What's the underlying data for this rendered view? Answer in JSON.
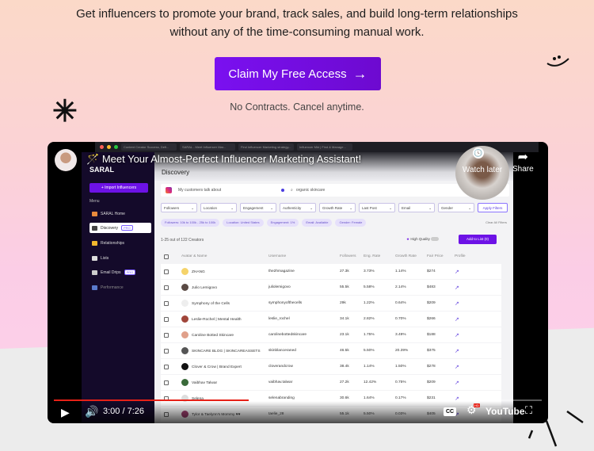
{
  "hero": {
    "line1": "Get influencers to promote your brand, track sales, and build long-term relationships",
    "line2": "without any of the time-consuming manual work.",
    "cta_label": "Claim My Free Access",
    "cta_arrow": "→",
    "subtext": "No Contracts. Cancel anytime."
  },
  "colors": {
    "accent": "#7a10f0",
    "youtube_red": "#e62117"
  },
  "video": {
    "title": "Meet Your Almost-Perfect Influencer Marketing Assistant!",
    "watch_later": "Watch later",
    "share": "Share",
    "time_current": "3:00",
    "time_total": "7:26",
    "time_display": "3:00 / 7:26",
    "progress_percent": 40,
    "cc_label": "CC",
    "hd_label": "HD",
    "youtube_label": "YouTube",
    "browser_tabs": [
      "Content Creator Success, Defi...",
      "SARAL - Meet Influencer Mar...",
      "Find Influencer Marketing strategy...",
      "Influencer Mkt | Find & Manage..."
    ]
  },
  "app": {
    "logo": "SARAL",
    "import_button": "+ Import Influencers",
    "menu_label": "Menu",
    "nav": [
      {
        "label": "SARAL Home",
        "badge": ""
      },
      {
        "label": "Discovery",
        "badge": "PRO"
      },
      {
        "label": "Relationships",
        "badge": ""
      },
      {
        "label": "Lists",
        "badge": ""
      },
      {
        "label": "Email Drips",
        "badge": "PRO"
      },
      {
        "label": "Performance",
        "badge": ""
      }
    ],
    "page_title": "Discovery",
    "search_left": "My customers talk about",
    "search_right": "organic skincare",
    "filters": [
      "Followers",
      "Location",
      "Engagement",
      "Authenticity",
      "Growth Rate",
      "Last Post",
      "Email",
      "Gender"
    ],
    "apply_filters": "Apply Filters",
    "chips": [
      "Followers: 10k to 100k - 25k to 100k",
      "Location: United States",
      "Engagement: 1%",
      "Email: Available",
      "Gender: Female"
    ],
    "clear_filters": "Clear All Filters",
    "result_count": "1-25 out of 122 Creators",
    "high_quality": "High Quality",
    "add_list": "Add to List (0)",
    "columns": [
      "Avatar & Name",
      "Username",
      "Followers",
      "Eng. Rate",
      "Growth Rate",
      "Fair Price",
      "Profile"
    ],
    "rows": [
      {
        "name": "ZHANG",
        "username": "the2hmagazine",
        "followers": "27.3k",
        "eng": "3.73%",
        "growth": "1.14%",
        "price": "$274"
      },
      {
        "name": "Julio Lemigovo",
        "username": "juliolemigovo",
        "followers": "55.5k",
        "eng": "5.58%",
        "growth": "2.14%",
        "price": "$483"
      },
      {
        "name": "Symphony of the Cells",
        "username": "symphonyofthecells",
        "followers": "29k",
        "eng": "1.22%",
        "growth": "0.64%",
        "price": "$209"
      },
      {
        "name": "Leslie-Rochel | Mental Health",
        "username": "leslie_rochel",
        "followers": "34.1k",
        "eng": "2.82%",
        "growth": "0.70%",
        "price": "$266"
      },
      {
        "name": "Caroline Botted Skincare",
        "username": "carolinebottedskincare",
        "followers": "23.1k",
        "eng": "1.75%",
        "growth": "3.49%",
        "price": "$188"
      },
      {
        "name": "SKINCARE BLOG | SKINCAREASSETS",
        "username": "skinblanceraned",
        "followers": "46.5k",
        "eng": "5.50%",
        "growth": "20.39%",
        "price": "$375"
      },
      {
        "name": "Clover & Crow | Brand Expert",
        "username": "cloverandcrow",
        "followers": "38.4k",
        "eng": "1.14%",
        "growth": "1.50%",
        "price": "$278"
      },
      {
        "name": "Vaibhav Talwar",
        "username": "vaibhav.talwar",
        "followers": "27.2k",
        "eng": "12.42%",
        "growth": "0.75%",
        "price": "$209"
      },
      {
        "name": "Selena",
        "username": "selenabranding",
        "followers": "30.6k",
        "eng": "1.64%",
        "growth": "0.17%",
        "price": "$231"
      },
      {
        "name": "Tylor & Taelynn's Mommy ♥♥",
        "username": "taelie_28",
        "followers": "55.1k",
        "eng": "5.50%",
        "growth": "0.03%",
        "price": "$405"
      }
    ]
  }
}
